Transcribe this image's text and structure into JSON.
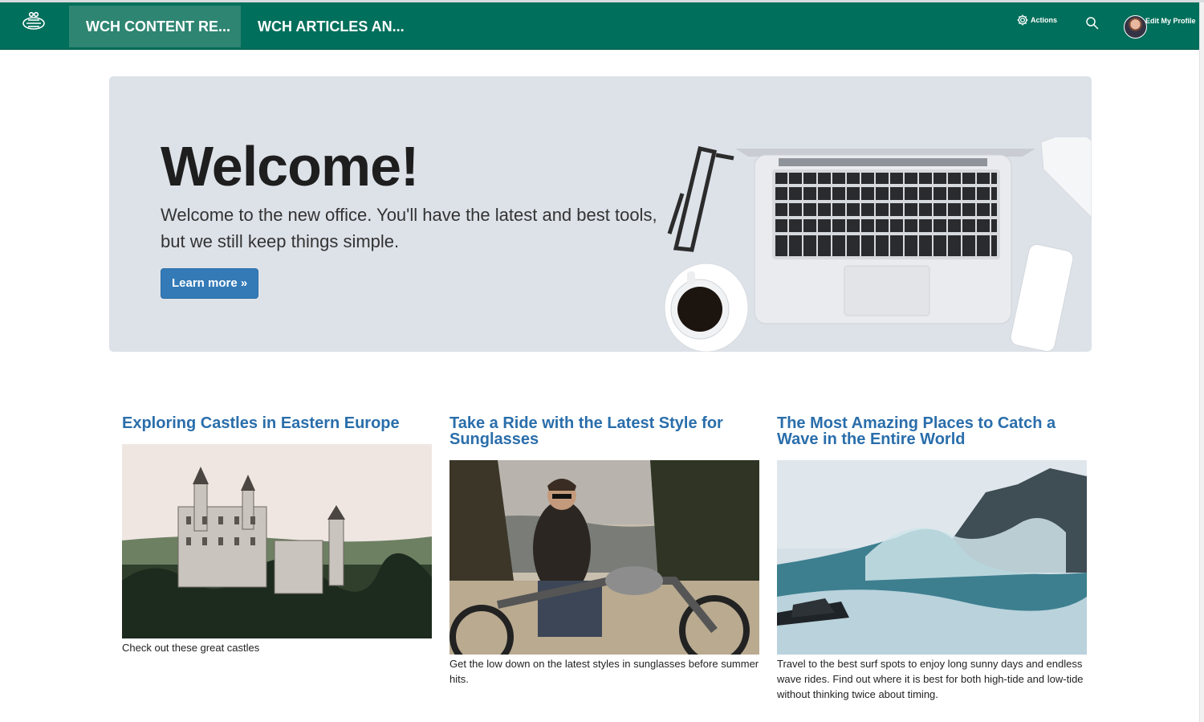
{
  "nav": {
    "tabs": [
      {
        "label": "WCH CONTENT RE...",
        "active": true
      },
      {
        "label": "WCH ARTICLES AN...",
        "active": false
      }
    ],
    "actions_label": "Actions",
    "profile_label": "Edit My Profile",
    "icons": [
      "bee-logo-icon",
      "gear-icon",
      "search-icon"
    ],
    "accent_color": "#006f5b"
  },
  "hero": {
    "title": "Welcome!",
    "text": "Welcome to the new office. You'll have the latest and best tools, but we still keep things simple.",
    "button_label": "Learn more »",
    "button_color": "#337ab7"
  },
  "articles": [
    {
      "title": "Exploring Castles in Eastern Europe",
      "summary": "Check out these great castles"
    },
    {
      "title": "Take a Ride with the Latest Style for Sunglasses",
      "summary": "Get the low down on the latest styles in sunglasses before summer hits."
    },
    {
      "title": "The Most Amazing Places to Catch a Wave in the Entire World",
      "summary": "Travel to the best surf spots to enjoy long sunny days and endless wave rides. Find out where it is best for both high-tide and low-tide without thinking twice about timing."
    }
  ]
}
